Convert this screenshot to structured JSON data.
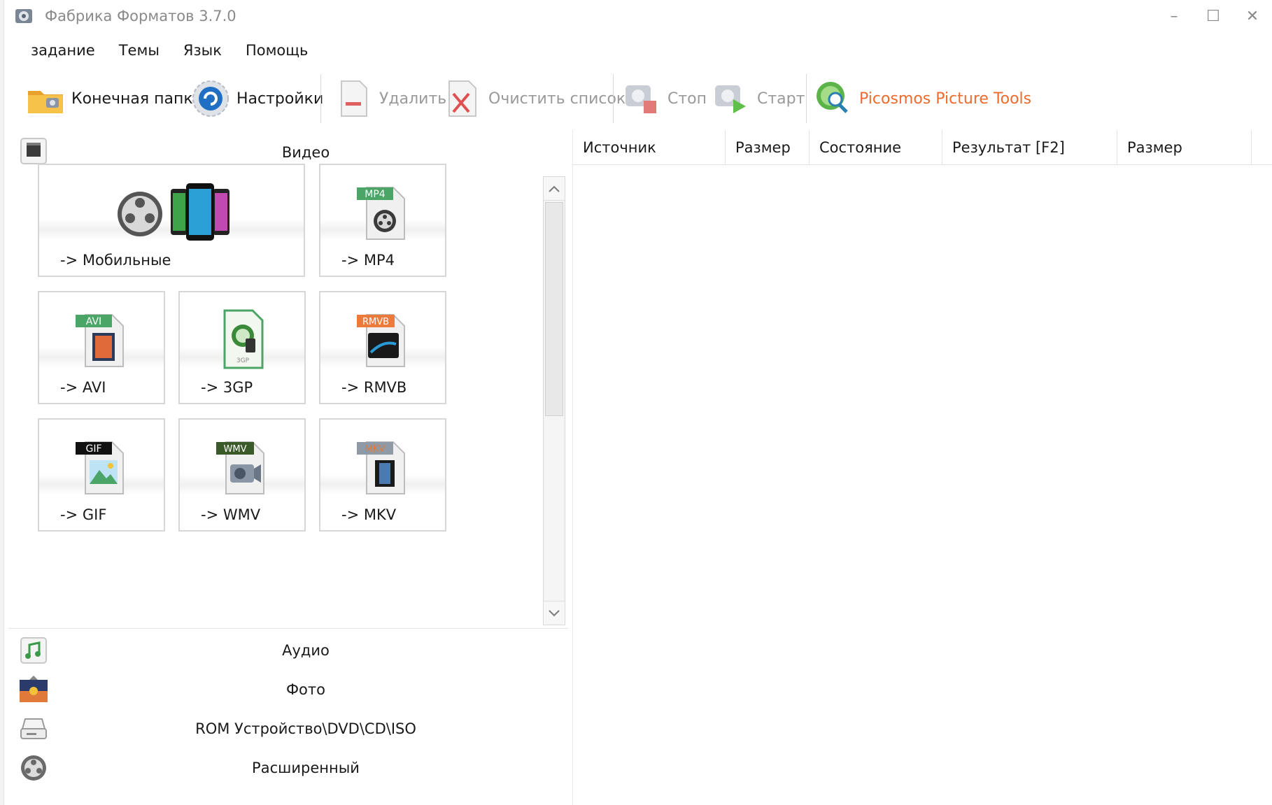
{
  "window": {
    "title": "Фабрика Форматов 3.7.0",
    "controls": [
      "–",
      "☐",
      "✕"
    ]
  },
  "menu": {
    "items": [
      "задание",
      "Темы",
      "Язык",
      "Помощь"
    ]
  },
  "toolbar": {
    "buttons": [
      {
        "label": "Конечная папка",
        "icon": "folder-icon"
      },
      {
        "label": "Настройки",
        "icon": "settings-icon"
      },
      {
        "label": "Удалить",
        "icon": "delete-icon"
      },
      {
        "label": "Очистить список",
        "icon": "clear-list-icon"
      },
      {
        "label": "Стоп",
        "icon": "stop-icon"
      },
      {
        "label": "Старт",
        "icon": "start-icon"
      },
      {
        "label": "Picosmos Picture Tools",
        "icon": "picosmos-icon"
      }
    ]
  },
  "categories": {
    "video": "Видео",
    "audio": "Аудио",
    "photo": "Фото",
    "rom": "ROM Устройство\\DVD\\CD\\ISO",
    "advanced": "Расширенный"
  },
  "video_tiles": [
    {
      "label": "-> Мобильные",
      "icon": "mobile-devices-icon"
    },
    {
      "label": "-> MP4",
      "icon": "mp4-file-icon",
      "badge": "MP4"
    },
    {
      "label": "-> AVI",
      "icon": "avi-file-icon",
      "badge": "AVI"
    },
    {
      "label": "-> 3GP",
      "icon": "3gp-file-icon",
      "badge": "3GP"
    },
    {
      "label": "-> RMVB",
      "icon": "rmvb-file-icon",
      "badge": "RMVB"
    },
    {
      "label": "-> GIF",
      "icon": "gif-file-icon",
      "badge": "GIF"
    },
    {
      "label": "-> WMV",
      "icon": "wmv-file-icon",
      "badge": "WMV"
    },
    {
      "label": "-> MKV",
      "icon": "mkv-file-icon",
      "badge": "MKV"
    }
  ],
  "file_list": {
    "columns": [
      "Источник",
      "Размер",
      "Состояние",
      "Результат [F2]",
      "Размер"
    ]
  },
  "colors": {
    "accent": "#ec6b2d",
    "disabled_text": "#9a9a9a",
    "tile_border": "#d7d7d7"
  }
}
